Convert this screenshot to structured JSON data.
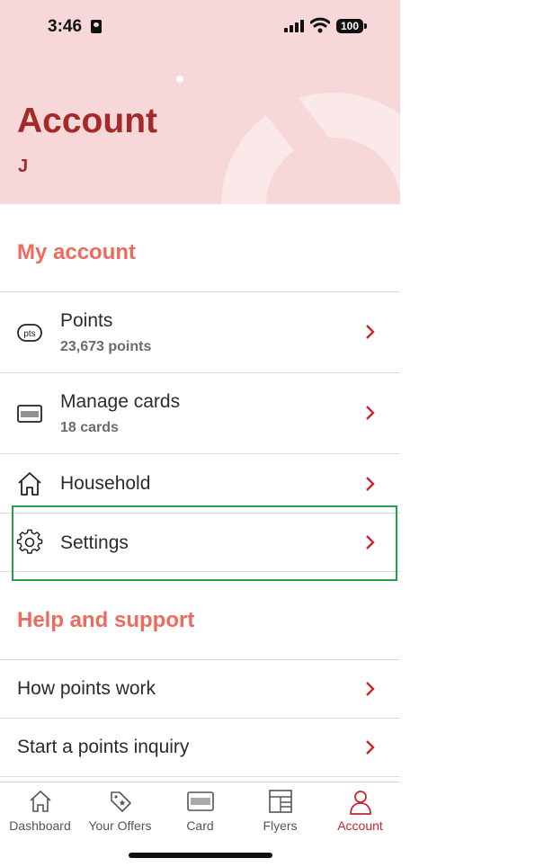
{
  "status_bar": {
    "time": "3:46",
    "battery": "100"
  },
  "header": {
    "title": "Account",
    "user_initial": "J"
  },
  "my_account": {
    "heading": "My account",
    "items": [
      {
        "title": "Points",
        "subtitle": "23,673 points",
        "icon": "pts",
        "icon_name": "points-icon"
      },
      {
        "title": "Manage cards",
        "subtitle": "18 cards",
        "icon_name": "card-icon"
      },
      {
        "title": "Household",
        "icon_name": "house-icon"
      },
      {
        "title": "Settings",
        "icon_name": "gear-icon"
      }
    ]
  },
  "help": {
    "heading": "Help and support",
    "items": [
      {
        "title": "How points work"
      },
      {
        "title": "Start a points inquiry"
      }
    ]
  },
  "tabbar": {
    "tabs": [
      {
        "label": "Dashboard",
        "icon_name": "house-icon"
      },
      {
        "label": "Your Offers",
        "icon_name": "tag-icon"
      },
      {
        "label": "Card",
        "icon_name": "card-icon"
      },
      {
        "label": "Flyers",
        "icon_name": "flyer-icon"
      },
      {
        "label": "Account",
        "icon_name": "person-icon",
        "active": true
      }
    ]
  },
  "colors": {
    "accent": "#c8252d",
    "heading": "#ee6a5e",
    "hero_bg": "#f7d7d7",
    "title": "#a42a2a",
    "highlight": "#22a04a"
  }
}
